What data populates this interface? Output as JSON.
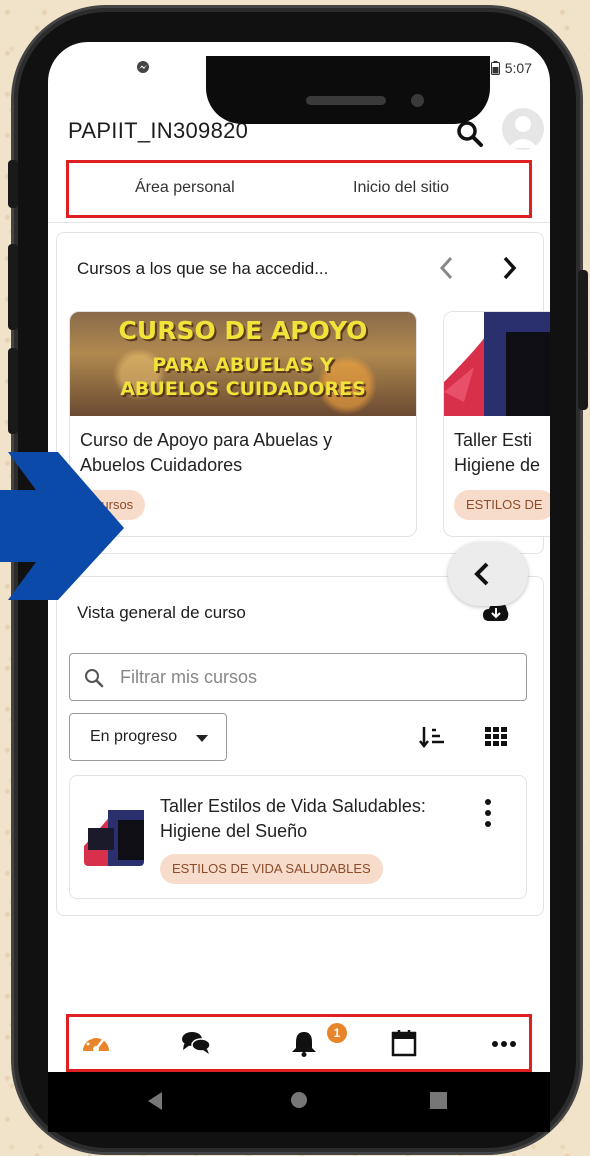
{
  "status_bar": {
    "time": "5:07"
  },
  "app": {
    "title": "PAPIIT_IN309820"
  },
  "tabs": [
    {
      "label": "Área personal"
    },
    {
      "label": "Inicio del sitio"
    }
  ],
  "recent_courses": {
    "title": "Cursos a los que se ha accedid...",
    "items": [
      {
        "name_line1": "Curso de Apoyo para Abuelas y",
        "name_line2": "Abuelos Cuidadores",
        "banner_line1": "CURSO DE APOYO",
        "banner_line2": "PARA ABUELAS Y",
        "banner_line3": "ABUELOS CUIDADORES",
        "chip": "Cursos"
      },
      {
        "name_line1": "Taller Esti",
        "name_line2": "Higiene de",
        "chip": "ESTILOS DE"
      }
    ]
  },
  "overview": {
    "title": "Vista general de curso",
    "filter_placeholder": "Filtrar mis cursos",
    "status_select": "En progreso",
    "course": {
      "name_line1": "Taller Estilos de Vida Saludables:",
      "name_line2": "Higiene del Sueño",
      "chip": "ESTILOS DE VIDA SALUDABLES"
    }
  },
  "bottom_nav": {
    "items": [
      "dashboard-icon",
      "messages-icon",
      "notifications-icon",
      "calendar-icon",
      "more-icon"
    ],
    "notification_count": "1"
  },
  "colors": {
    "accent": "#e8842a",
    "highlight_box": "#e02020",
    "chip_bg": "#f8dccb",
    "arrow": "#0b4aa8"
  }
}
